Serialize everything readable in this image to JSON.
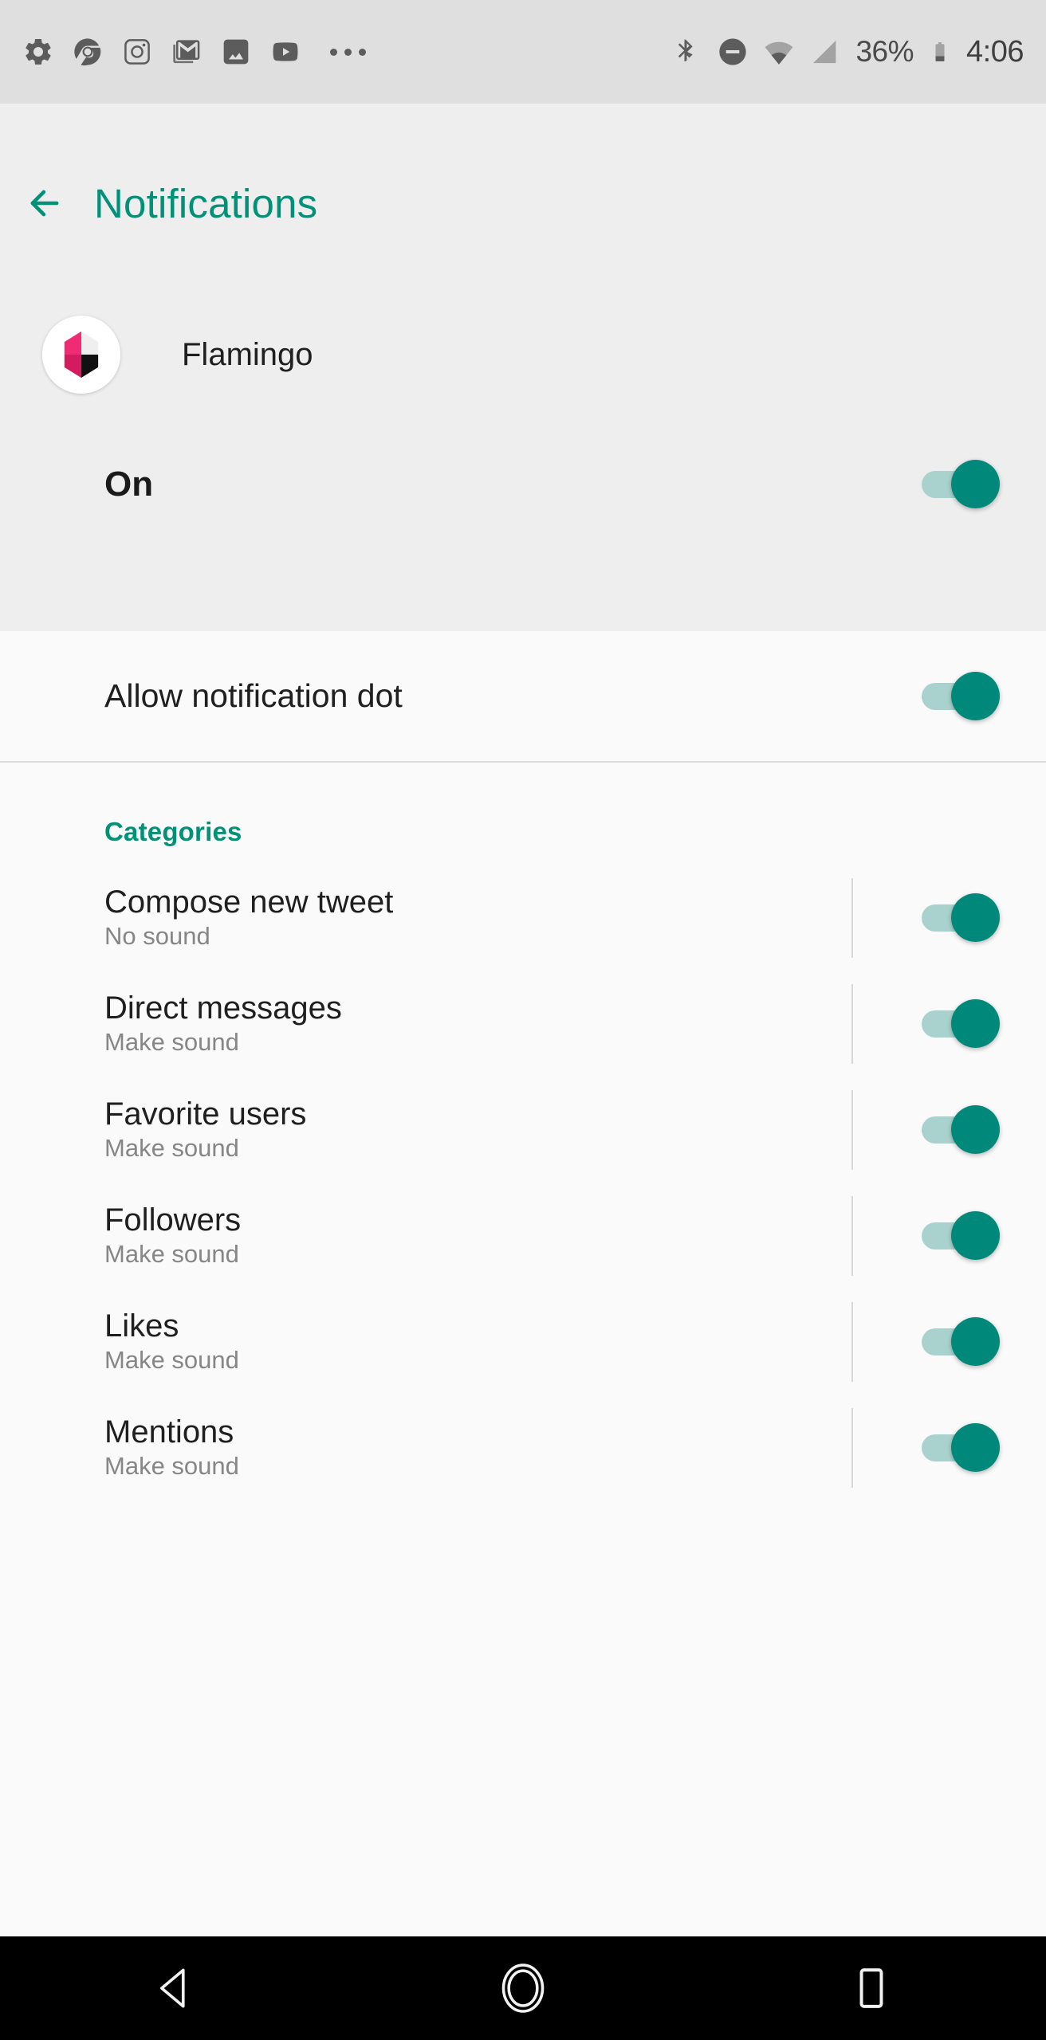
{
  "status_bar": {
    "left_icons": [
      {
        "name": "settings-gear-icon",
        "label": "Settings"
      },
      {
        "name": "chrome-icon",
        "label": "Chrome"
      },
      {
        "name": "instagram-icon",
        "label": "Instagram"
      },
      {
        "name": "gmail-icon",
        "label": "Gmail"
      },
      {
        "name": "photos-icon",
        "label": "Photos"
      },
      {
        "name": "youtube-icon",
        "label": "YouTube"
      }
    ],
    "overflow": "more-notifications-icon",
    "right_icons": [
      {
        "name": "bluetooth-icon",
        "label": "Bluetooth"
      },
      {
        "name": "do-not-disturb-icon",
        "label": "Do not disturb"
      },
      {
        "name": "wifi-icon",
        "label": "Wi-Fi"
      },
      {
        "name": "cellular-signal-icon",
        "label": "Cellular signal"
      }
    ],
    "battery_percent": "36%",
    "time": "4:06",
    "background_color": "#DFDFDF"
  },
  "header": {
    "back_icon": "arrow-back-icon",
    "title": "Notifications",
    "accent_color": "#009178",
    "background_color": "#EEEEEE",
    "app": {
      "name": "Flamingo",
      "icon": "flamingo-app-icon",
      "icon_colors": {
        "pink": "#EC1E6A",
        "pink_dark": "#D41B5F",
        "light": "#E9E9E9",
        "black": "#111111",
        "circle": "#FFFFFF"
      }
    },
    "master_toggle": {
      "label": "On",
      "state": "on"
    }
  },
  "content": {
    "background_color": "#FAFAFA",
    "notification_dot": {
      "label": "Allow notification dot",
      "state": "on"
    },
    "categories_header": "Categories",
    "categories": [
      {
        "title": "Compose new tweet",
        "subtitle": "No sound",
        "state": "on"
      },
      {
        "title": "Direct messages",
        "subtitle": "Make sound",
        "state": "on"
      },
      {
        "title": "Favorite users",
        "subtitle": "Make sound",
        "state": "on"
      },
      {
        "title": "Followers",
        "subtitle": "Make sound",
        "state": "on"
      },
      {
        "title": "Likes",
        "subtitle": "Make sound",
        "state": "on"
      },
      {
        "title": "Mentions",
        "subtitle": "Make sound",
        "state": "on"
      }
    ]
  },
  "nav_bar": {
    "background_color": "#000000",
    "buttons": [
      {
        "name": "back-nav-button",
        "label": "Back"
      },
      {
        "name": "home-nav-button",
        "label": "Home"
      },
      {
        "name": "recents-nav-button",
        "label": "Recents"
      }
    ]
  },
  "theme": {
    "toggle_track": "#A9D2CE",
    "toggle_thumb": "#00897B",
    "primary_text": "#1F1F1F",
    "secondary_text": "#868686"
  }
}
